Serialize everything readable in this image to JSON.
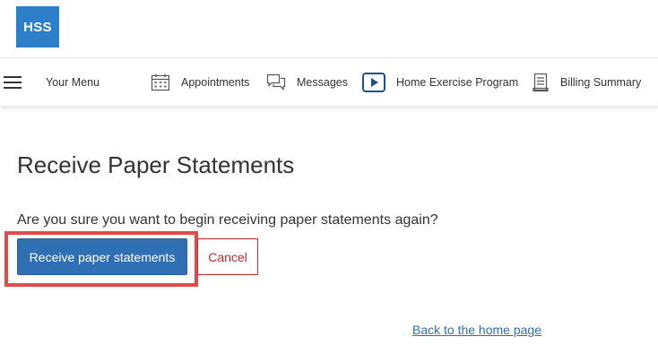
{
  "logo": {
    "text": "HSS"
  },
  "nav": {
    "menu_label": "Your Menu",
    "items": [
      {
        "label": "Appointments",
        "icon": "calendar-icon"
      },
      {
        "label": "Messages",
        "icon": "messages-icon"
      },
      {
        "label": "Home Exercise Program",
        "icon": "play-icon"
      },
      {
        "label": "Billing Summary",
        "icon": "document-icon"
      }
    ]
  },
  "main": {
    "title": "Receive Paper Statements",
    "question": "Are you sure you want to begin receiving paper statements again?",
    "confirm_label": "Receive paper statements",
    "cancel_label": "Cancel",
    "home_link": "Back to the home page"
  },
  "colors": {
    "brand": "#2d7fc9",
    "primary_button": "#2f6fb3",
    "cancel": "#c62828",
    "highlight": "#e34a4a"
  }
}
